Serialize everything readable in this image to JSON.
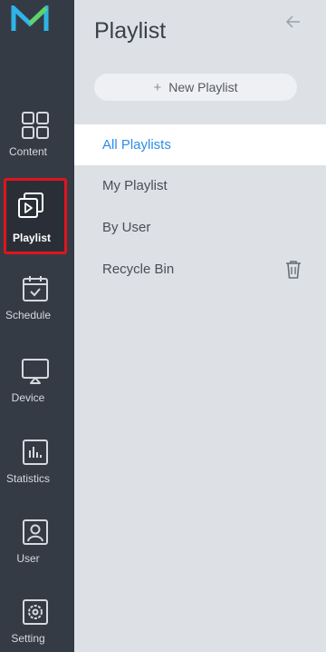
{
  "rail": {
    "logo": "m-logo",
    "items": [
      {
        "label": "Content",
        "icon": "grid-icon"
      },
      {
        "label": "Playlist",
        "icon": "playlist-icon",
        "active": true
      },
      {
        "label": "Schedule",
        "icon": "calendar-icon"
      },
      {
        "label": "Device",
        "icon": "monitor-icon"
      },
      {
        "label": "Statistics",
        "icon": "chart-icon"
      },
      {
        "label": "User",
        "icon": "user-icon"
      },
      {
        "label": "Setting",
        "icon": "gear-icon"
      }
    ]
  },
  "panel": {
    "title": "Playlist",
    "new_button": {
      "plus": "+",
      "label": "New Playlist"
    },
    "items": [
      {
        "label": "All Playlists",
        "active": true
      },
      {
        "label": "My Playlist"
      },
      {
        "label": "By User"
      },
      {
        "label": "Recycle Bin"
      }
    ]
  },
  "colors": {
    "rail_bg": "#353b45",
    "panel_bg": "#dde1e6",
    "accent": "#2d8ee8",
    "highlight_border": "#e0141e"
  }
}
